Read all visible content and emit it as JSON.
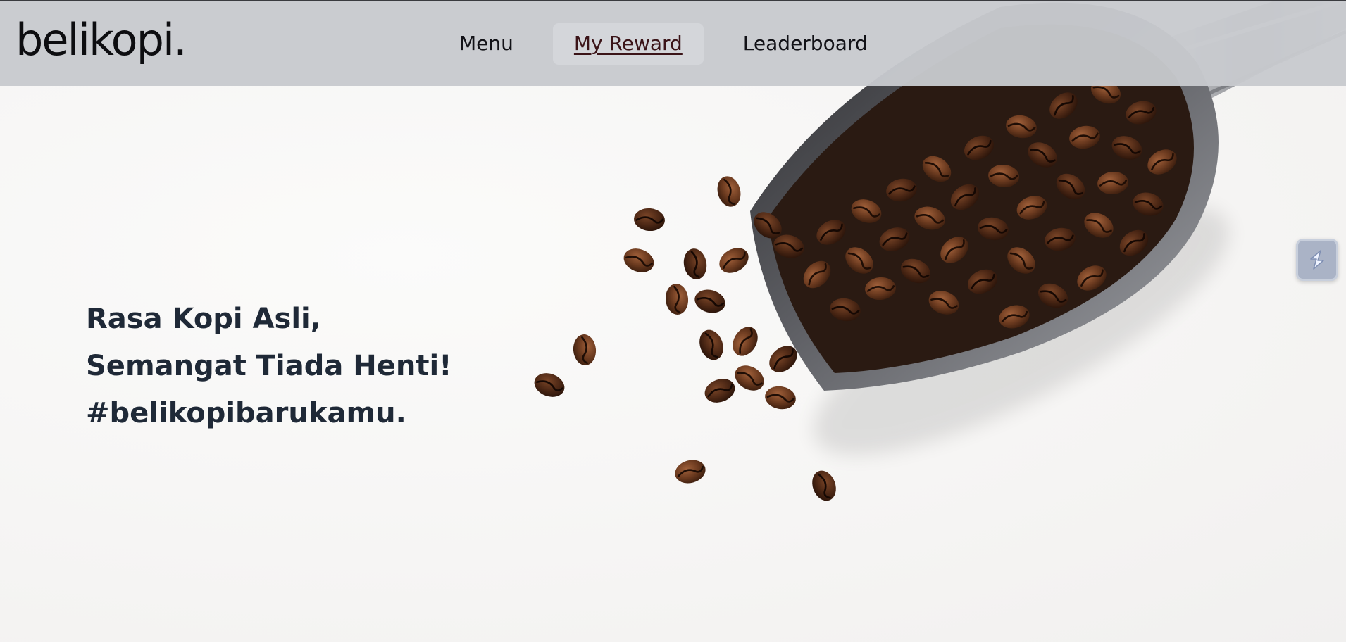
{
  "brand": {
    "name": "belikopi."
  },
  "nav": {
    "items": [
      {
        "label": "Menu"
      },
      {
        "label": "My Reward"
      },
      {
        "label": "Leaderboard"
      }
    ],
    "active": "My Reward"
  },
  "hero": {
    "lines": [
      "Rasa Kopi Asli,",
      "Semangat Tiada Henti!",
      "#belikopibarukamu."
    ],
    "image_icon": "coffee-scoop-beans-image"
  },
  "side_widget": {
    "icon": "s-logo-icon"
  },
  "colors": {
    "header_bg": "#c8cace",
    "page_bg": "#f6f5f4",
    "headline": "#1f2937",
    "active_link": "#3b1418",
    "widget": "#aab3c6"
  }
}
